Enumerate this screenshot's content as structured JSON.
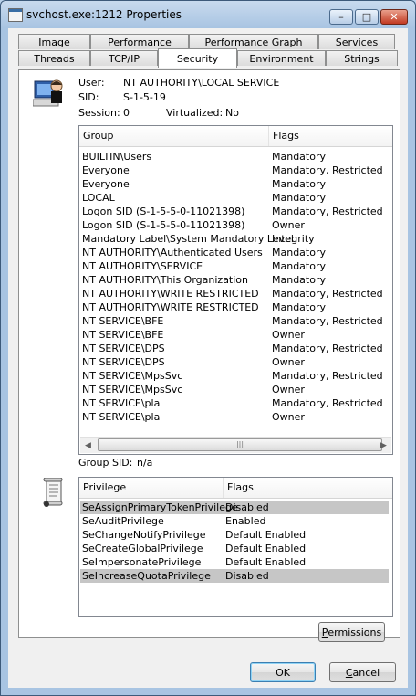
{
  "window": {
    "title": "svchost.exe:1212 Properties",
    "minimize": "–",
    "maximize": "□",
    "close": "✕"
  },
  "tabs_row1": [
    "Image",
    "Performance",
    "Performance Graph",
    "Services"
  ],
  "tabs_row2": [
    "Threads",
    "TCP/IP",
    "Security",
    "Environment",
    "Strings"
  ],
  "user": {
    "user_label": "User:",
    "user_value": "NT AUTHORITY\\LOCAL SERVICE",
    "sid_label": "SID:",
    "sid_value": "S-1-5-19",
    "session_label": "Session:",
    "session_value": "0",
    "virtualized_label": "Virtualized:",
    "virtualized_value": "No"
  },
  "groups": {
    "columns": [
      "Group",
      "Flags"
    ],
    "rows": [
      [
        "BUILTIN\\Users",
        "Mandatory"
      ],
      [
        "Everyone",
        "Mandatory, Restricted"
      ],
      [
        "Everyone",
        "Mandatory"
      ],
      [
        "LOCAL",
        "Mandatory"
      ],
      [
        "Logon SID (S-1-5-5-0-11021398)",
        "Mandatory, Restricted"
      ],
      [
        "Logon SID (S-1-5-5-0-11021398)",
        "Owner"
      ],
      [
        "Mandatory Label\\System Mandatory Level",
        "Integrity"
      ],
      [
        "NT AUTHORITY\\Authenticated Users",
        "Mandatory"
      ],
      [
        "NT AUTHORITY\\SERVICE",
        "Mandatory"
      ],
      [
        "NT AUTHORITY\\This Organization",
        "Mandatory"
      ],
      [
        "NT AUTHORITY\\WRITE RESTRICTED",
        "Mandatory, Restricted"
      ],
      [
        "NT AUTHORITY\\WRITE RESTRICTED",
        "Mandatory"
      ],
      [
        "NT SERVICE\\BFE",
        "Mandatory, Restricted"
      ],
      [
        "NT SERVICE\\BFE",
        "Owner"
      ],
      [
        "NT SERVICE\\DPS",
        "Mandatory, Restricted"
      ],
      [
        "NT SERVICE\\DPS",
        "Owner"
      ],
      [
        "NT SERVICE\\MpsSvc",
        "Mandatory, Restricted"
      ],
      [
        "NT SERVICE\\MpsSvc",
        "Owner"
      ],
      [
        "NT SERVICE\\pla",
        "Mandatory, Restricted"
      ],
      [
        "NT SERVICE\\pla",
        "Owner"
      ]
    ],
    "group_sid_label": "Group SID:",
    "group_sid_value": "n/a"
  },
  "privileges": {
    "columns": [
      "Privilege",
      "Flags"
    ],
    "rows": [
      [
        "SeAssignPrimaryTokenPrivilege",
        "Disabled"
      ],
      [
        "SeAuditPrivilege",
        "Enabled"
      ],
      [
        "SeChangeNotifyPrivilege",
        "Default Enabled"
      ],
      [
        "SeCreateGlobalPrivilege",
        "Default Enabled"
      ],
      [
        "SeImpersonatePrivilege",
        "Default Enabled"
      ],
      [
        "SeIncreaseQuotaPrivilege",
        "Disabled"
      ]
    ],
    "highlighted_rows": [
      0,
      5
    ]
  },
  "buttons": {
    "permissions_first": "P",
    "permissions_rest": "ermissions",
    "ok": "OK",
    "cancel_first": "C",
    "cancel_rest": "ancel"
  },
  "icons": {
    "user": "user-computer-icon",
    "privilege": "scroll-document-icon"
  },
  "colors": {
    "highlight_row": "#c6c6c6",
    "title_gradient": "#a8c4e2"
  }
}
